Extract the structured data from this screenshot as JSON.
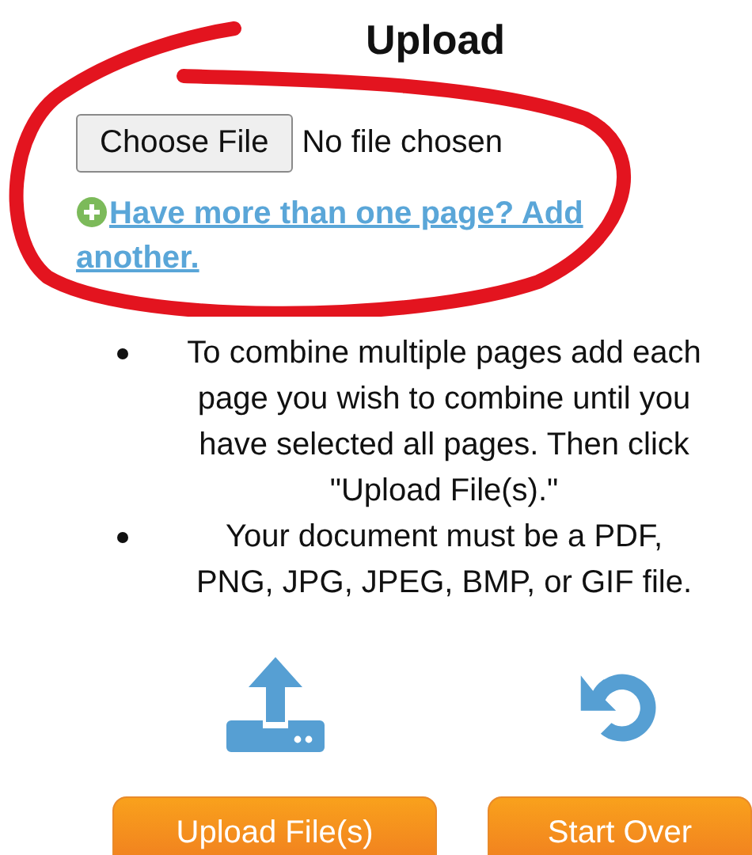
{
  "title": "Upload",
  "file_input": {
    "button": "Choose File",
    "status": "No file chosen"
  },
  "add_page_link": "Have more than one page? Add another.",
  "instructions": [
    "To combine multiple pages add each page you wish to combine until you have selected all pages. Then click \"Upload File(s).\"",
    "Your document must be a PDF, PNG, JPG, JPEG, BMP, or GIF file."
  ],
  "actions": [
    {
      "kind": "upload",
      "label": "Upload File(s)"
    },
    {
      "kind": "restart",
      "label": "Start Over"
    }
  ]
}
